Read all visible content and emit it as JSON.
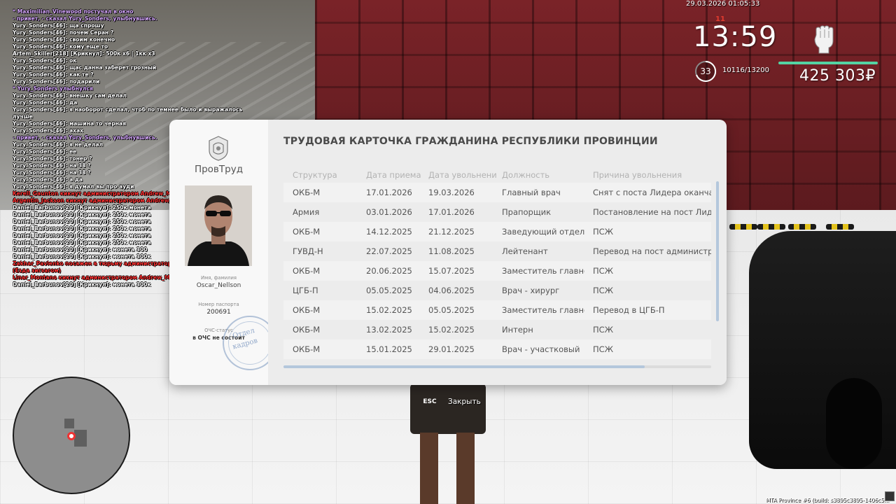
{
  "chat": [
    {
      "text": "* Maximilian_Vinewood постучал в окно",
      "color": "#d7a8ff"
    },
    {
      "text": " - привет, - сказал Yury_Sonders, улыбнувшись.",
      "color": "#d7a8ff"
    },
    {
      "text": "Yury_Sonders[46]: ща спрошу",
      "color": "#ffffff"
    },
    {
      "text": "Yury_Sonders[46]: почем Серан ?",
      "color": "#ffffff"
    },
    {
      "text": "Yury_Sonders[46]: своим конечно",
      "color": "#ffffff"
    },
    {
      "text": "Yury_Sonders[46]: кому еще то",
      "color": "#ffffff"
    },
    {
      "text": "Artem_Skiller[218] [Крикнул]: 500к х6 | 1кк х3",
      "color": "#ffffff"
    },
    {
      "text": "Yury_Sonders[46]: ок",
      "color": "#ffffff"
    },
    {
      "text": "Yury_Sonders[46]: щас данна заберет грозный",
      "color": "#ffffff"
    },
    {
      "text": "Yury_Sonders[46]: как те ?",
      "color": "#ffffff"
    },
    {
      "text": "Yury_Sonders[46]: подарили",
      "color": "#ffffff"
    },
    {
      "text": "* Yury_Sonders улыбнулся",
      "color": "#d7a8ff"
    },
    {
      "text": "Yury_Sonders[46]: внешку сам делал",
      "color": "#ffffff"
    },
    {
      "text": "Yury_Sonders[46]: да",
      "color": "#ffffff"
    },
    {
      "text": "Yury_Sonders[46]: я наоборот сделал, чтоб по темнее было и выражалось по",
      "color": "#ffffff"
    },
    {
      "text": "лучше",
      "color": "#ffffff"
    },
    {
      "text": "Yury_Sonders[46]: машина то черная",
      "color": "#ffffff"
    },
    {
      "text": "Yury_Sonders[46]: ахах",
      "color": "#ffffff"
    },
    {
      "text": " - привет, - сказал Yury_Sonders, улыбнувшись.",
      "color": "#d7a8ff"
    },
    {
      "text": "Yury_Sonders[46]: я не делал",
      "color": "#ffffff"
    },
    {
      "text": "Yury_Sonders[46]: ее",
      "color": "#ffffff"
    },
    {
      "text": "Yury_Sonders[46]: тонер ?",
      "color": "#ffffff"
    },
    {
      "text": "Yury_Sonders[46]: на 38 ?",
      "color": "#ffffff"
    },
    {
      "text": "Yury_Sonders[46]: на 38 ?",
      "color": "#ffffff"
    },
    {
      "text": "Yury_Sonders[46]: а да",
      "color": "#ffffff"
    },
    {
      "text": "Yury_Sonders[46]: я думал вы про ауди",
      "color": "#ffffff"
    },
    {
      "text": "Kerell_Gaunton кикнут администратором Andrew_Maguire (AFK койка)",
      "color": "#ff3030"
    },
    {
      "text": "Argentin_Jackson кикнут администратором Andrew_Maguire (AFK 30+)",
      "color": "#ff3030"
    },
    {
      "text": "Daniel_Barbunov[20] [Крикнул]: 250к монета",
      "color": "#ffffff"
    },
    {
      "text": "Daniel_Barbunov[20] [Крикнул]: 250к монета",
      "color": "#ffffff"
    },
    {
      "text": "Daniel_Barbunov[20] [Крикнул]: 250к монета",
      "color": "#ffffff"
    },
    {
      "text": "Daniel_Barbunov[20] [Крикнул]: 250к монета",
      "color": "#ffffff"
    },
    {
      "text": "Daniel_Barbunov[20] [Крикнул]: 250к монета",
      "color": "#ffffff"
    },
    {
      "text": "Daniel_Barbunov[20] [Крикнул]: 250к монета",
      "color": "#ffffff"
    },
    {
      "text": "Daniel_Barbunov[20] [Крикнул]: монета 300",
      "color": "#ffffff"
    },
    {
      "text": "Daniel_Barbunov[20] [Крикнул]: монета 300к",
      "color": "#ffffff"
    },
    {
      "text": "Zakhar_Pavlenko посажен в тюрьму администратором Andrew_Maguire (30 мин.)",
      "color": "#ff3030"
    },
    {
      "text": " (Езда зигзагом)",
      "color": "#ff3030"
    },
    {
      "text": "Linar_Montano кикнут администратором Andrew_Maguire (AFK 30+)",
      "color": "#ff3030"
    },
    {
      "text": "Daniel_Barbunov[20] [Крикнул]: монета 300к",
      "color": "#ffffff"
    }
  ],
  "hud": {
    "datetime": "29.03.2026 01:05:33",
    "clock_ticks": "11",
    "clock": "13:59",
    "level": "33",
    "xp": "10116/13200",
    "money": "425 303₽",
    "fist_icon": "fist-icon"
  },
  "card": {
    "org": "ПровТруд",
    "emblem_icon": "emblem-icon",
    "name_label": "Имя, фамилия",
    "name": "Oscar_Nellson",
    "passport_label": "Номер паспорта",
    "passport": "200691",
    "och_label": "ОЧС-статус",
    "och_value": "в ОЧС не состоит",
    "stamp_line1": "Отдел",
    "stamp_line2": "кадров",
    "title": "ТРУДОВАЯ КАРТОЧКА ГРАЖДАНИНА РЕСПУБЛИКИ ПРОВИНЦИИ",
    "headers": [
      "Структура",
      "Дата приема",
      "Дата увольнени",
      "Должность",
      "Причина увольнения"
    ],
    "rows": [
      [
        "ОКБ-М",
        "17.01.2026",
        "19.03.2026",
        "Главный врач",
        "Снят с поста Лидера оканчательно"
      ],
      [
        "Армия",
        "03.01.2026",
        "17.01.2026",
        "Прапорщик",
        "Постановление на пост Лидера"
      ],
      [
        "ОКБ-М",
        "14.12.2025",
        "21.12.2025",
        "Заведующий отделением",
        "ПСЖ"
      ],
      [
        "ГУВД-Н",
        "22.07.2025",
        "11.08.2025",
        "Лейтенант",
        "Перевод на пост администратора"
      ],
      [
        "ОКБ-М",
        "20.06.2025",
        "15.07.2025",
        "Заместитель главного врача",
        "ПСЖ"
      ],
      [
        "ЦГБ-П",
        "05.05.2025",
        "04.06.2025",
        "Врач - хирург",
        "ПСЖ"
      ],
      [
        "ОКБ-М",
        "15.02.2025",
        "05.05.2025",
        "Заместитель главного врача",
        "Перевод в ЦГБ-П"
      ],
      [
        "ОКБ-М",
        "13.02.2025",
        "15.02.2025",
        "Интерн",
        "ПСЖ"
      ],
      [
        "ОКБ-М",
        "15.01.2025",
        "29.01.2025",
        "Врач - участковый",
        "ПСЖ"
      ]
    ]
  },
  "close_hint": {
    "key": "ESC",
    "label": "Закрыть"
  },
  "build": "MTA Province #6 (build: s3895c3895-1406c5..."
}
